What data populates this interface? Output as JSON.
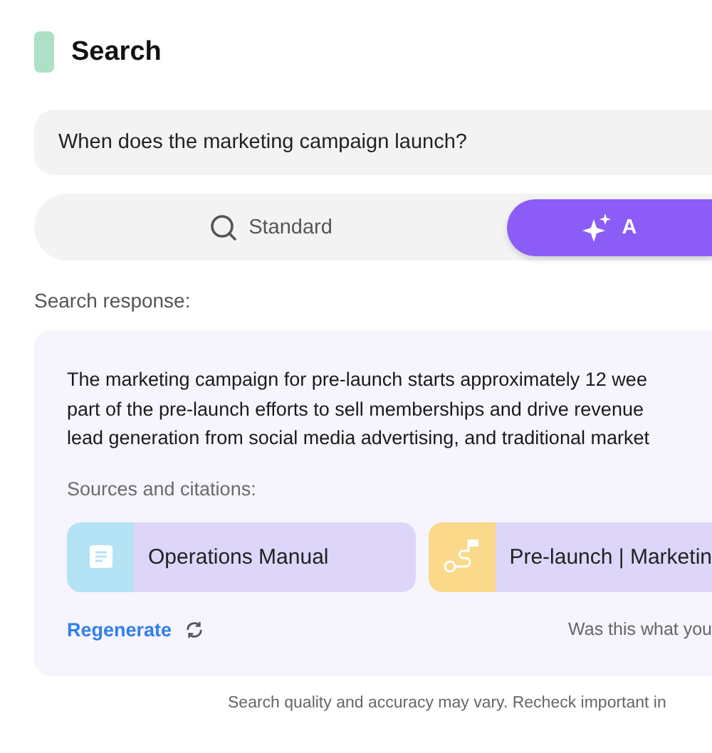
{
  "header": {
    "title": "Search"
  },
  "query": {
    "value": "When does the marketing campaign launch?"
  },
  "modes": [
    {
      "label": "Standard",
      "kind": "search",
      "selected": false
    },
    {
      "label": "A",
      "kind": "sparkle",
      "selected": true
    }
  ],
  "response_label": "Search response:",
  "answer_lines": [
    "The marketing campaign for pre-launch starts approximately 12 wee",
    "part of the pre-launch efforts to sell memberships and drive revenue",
    "lead generation from social media advertising, and traditional market"
  ],
  "sources_label": "Sources and citations:",
  "sources": [
    {
      "title": "Operations Manual",
      "kind": "document",
      "color": "#b3e3f5"
    },
    {
      "title": "Pre-launch | Marketin",
      "kind": "route",
      "color": "#fbd98a"
    }
  ],
  "regenerate": "Regenerate",
  "feedback_prompt": "Was this what you",
  "disclaimer": "Search quality and accuracy may vary. Recheck important in"
}
